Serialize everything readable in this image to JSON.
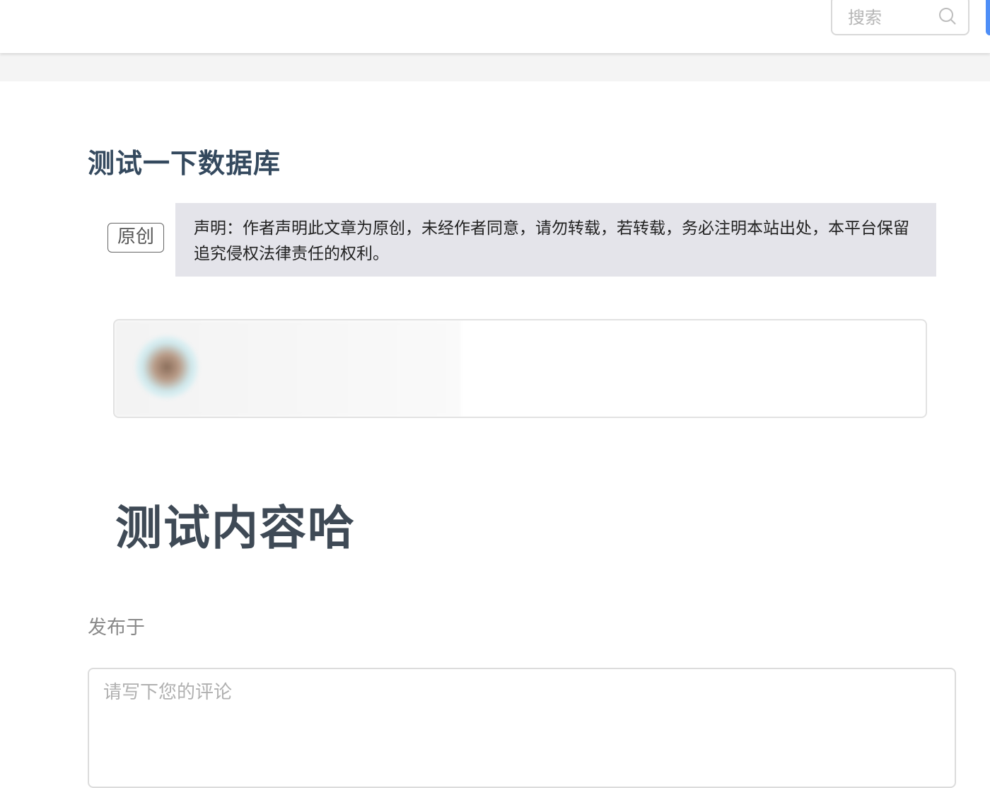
{
  "header": {
    "search": {
      "placeholder": "搜索",
      "icon": "search-icon"
    },
    "accent_color": "#4e8ef7"
  },
  "article": {
    "title": "测试一下数据库",
    "badge": "原创",
    "notice": "声明：作者声明此文章为原创，未经作者同意，请勿转载，若转载，务必注明本站出处，本平台保留追究侵权法律责任的权利。",
    "link_card": {
      "name": "",
      "description": ""
    },
    "content_heading": "测试内容哈",
    "published_label": "发布于",
    "published_time": ""
  },
  "comment": {
    "placeholder": "请写下您的评论"
  },
  "colors": {
    "title": "#34495e",
    "notice_bg": "#e4e4ea",
    "muted": "#8a8a8a"
  }
}
